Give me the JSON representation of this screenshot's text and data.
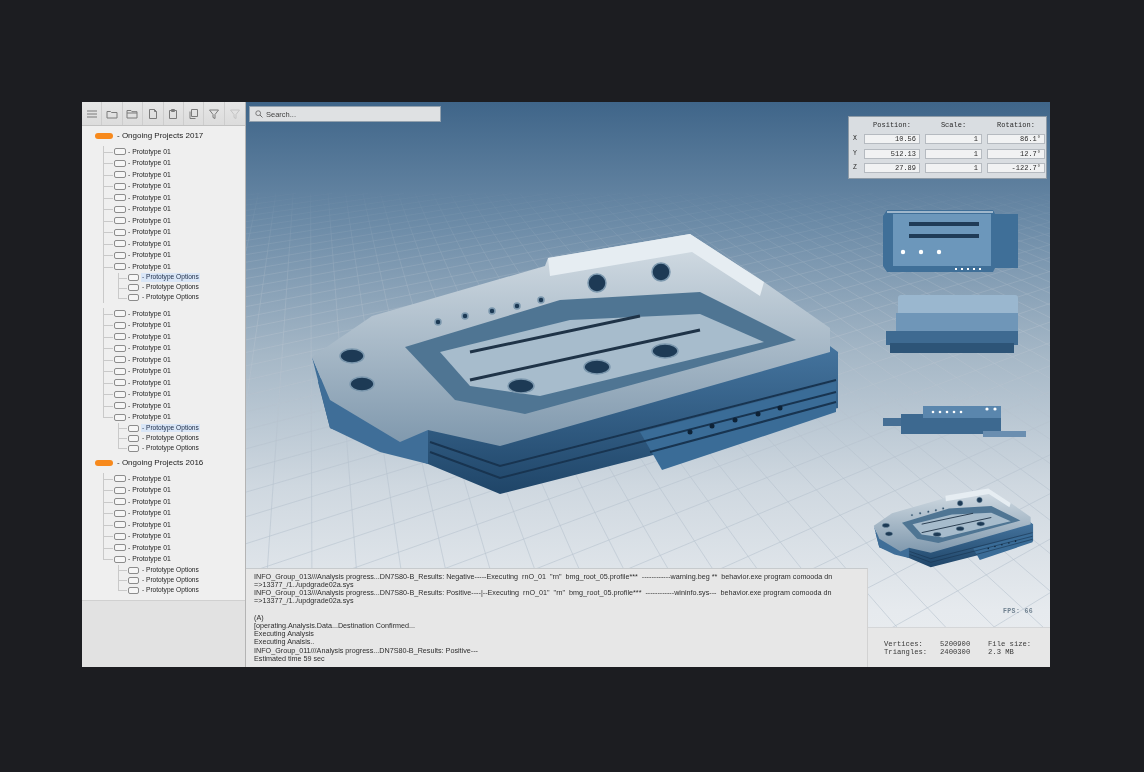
{
  "sidebar": {
    "toolbar": [
      {
        "disabled": false
      },
      {
        "disabled": false
      },
      {
        "disabled": false
      },
      {
        "disabled": false
      },
      {
        "disabled": false
      },
      {
        "disabled": false
      },
      {
        "disabled": false
      },
      {
        "disabled": true
      }
    ],
    "tree": [
      {
        "label": "- Ongoing Projects 2017",
        "selected": false,
        "children": [
          {
            "label": "- Prototype 01",
            "selected": false
          },
          {
            "label": "- Prototype 01",
            "selected": false
          },
          {
            "label": "- Prototype 01",
            "selected": false
          },
          {
            "label": "- Prototype 01",
            "selected": false
          },
          {
            "label": "- Prototype 01",
            "selected": false
          },
          {
            "label": "- Prototype 01",
            "selected": false
          },
          {
            "label": "- Prototype 01",
            "selected": false
          },
          {
            "label": "- Prototype 01",
            "selected": false
          },
          {
            "label": "- Prototype 01",
            "selected": false
          },
          {
            "label": "- Prototype 01",
            "selected": false
          },
          {
            "label": "- Prototype 01",
            "selected": false,
            "children": [
              {
                "label": "- Prototype Options",
                "selected": true
              },
              {
                "label": "- Prototype Options",
                "selected": false
              },
              {
                "label": "- Prototype Options",
                "selected": false
              }
            ]
          },
          {
            "label": "- Prototype 01",
            "selected": false
          },
          {
            "label": "- Prototype 01",
            "selected": false
          },
          {
            "label": "- Prototype 01",
            "selected": false
          },
          {
            "label": "- Prototype 01",
            "selected": false
          },
          {
            "label": "- Prototype 01",
            "selected": false
          },
          {
            "label": "- Prototype 01",
            "selected": false
          },
          {
            "label": "- Prototype 01",
            "selected": false
          },
          {
            "label": "- Prototype 01",
            "selected": false
          },
          {
            "label": "- Prototype 01",
            "selected": false
          },
          {
            "label": "- Prototype 01",
            "selected": false,
            "children": [
              {
                "label": "- Prototype Options",
                "selected": true
              },
              {
                "label": "- Prototype Options",
                "selected": false
              },
              {
                "label": "- Prototype Options",
                "selected": false
              }
            ]
          }
        ]
      },
      {
        "label": "- Ongoing Projects 2016",
        "selected": false,
        "children": [
          {
            "label": "- Prototype 01",
            "selected": false
          },
          {
            "label": "- Prototype 01",
            "selected": false
          },
          {
            "label": "- Prototype 01",
            "selected": false
          },
          {
            "label": "- Prototype 01",
            "selected": false
          },
          {
            "label": "- Prototype 01",
            "selected": false
          },
          {
            "label": "- Prototype 01",
            "selected": false
          },
          {
            "label": "- Prototype 01",
            "selected": false
          },
          {
            "label": "- Prototype 01",
            "selected": false,
            "children": [
              {
                "label": "- Prototype Options",
                "selected": false
              },
              {
                "label": "- Prototype Options",
                "selected": false
              },
              {
                "label": "- Prototype Options",
                "selected": false
              }
            ]
          }
        ]
      }
    ]
  },
  "viewport": {
    "search": {
      "placeholder": "Search..."
    },
    "transform": {
      "columns": [
        "Position:",
        "Scale:",
        "Rotation:"
      ],
      "rows": [
        {
          "axis": "X",
          "values": [
            "10.56",
            "1",
            "86.1°"
          ]
        },
        {
          "axis": "Y",
          "values": [
            "512.13",
            "1",
            "12.7°"
          ]
        },
        {
          "axis": "Z",
          "values": [
            "27.89",
            "1",
            "-122.7°"
          ]
        }
      ]
    },
    "fps": "FPS: 66"
  },
  "log": {
    "blocks": [
      [
        "INFO_Group_013///Analysis progress...DN7S80-B_Results: Negative-----Executing  rnO_01  \"rn\"  bmg_root_05.profile***  ------------warning.beg **  behavior.exe program comooda dn =>13377_/1../updgrade02a.sys",
        "INFO_Group_013///Analysis progress...DN7S80-B_Results: Positive----|--Executing  rnO_01\"  \"rn\"  bmg_root_05.profile***  ------------wininfo.sys---  behavior.exe program comooda dn =>13377_/1../updgrade02a.sys"
      ],
      [
        "(A)",
        "[operating.Analysis.Data...Destination Confirmed...",
        "Executing Analysis",
        "Executing Analsis..",
        "INFO_Group_011///Analysis progress...DN7S80-B_Results: Positive---",
        "Estimated time 59 sec"
      ]
    ]
  },
  "stats": {
    "items": [
      {
        "label": "Vertices:",
        "value": "5200900"
      },
      {
        "label": "Triangles:",
        "value": "2400300"
      },
      {
        "label": "File size:",
        "value": "2.3 MB"
      }
    ]
  }
}
